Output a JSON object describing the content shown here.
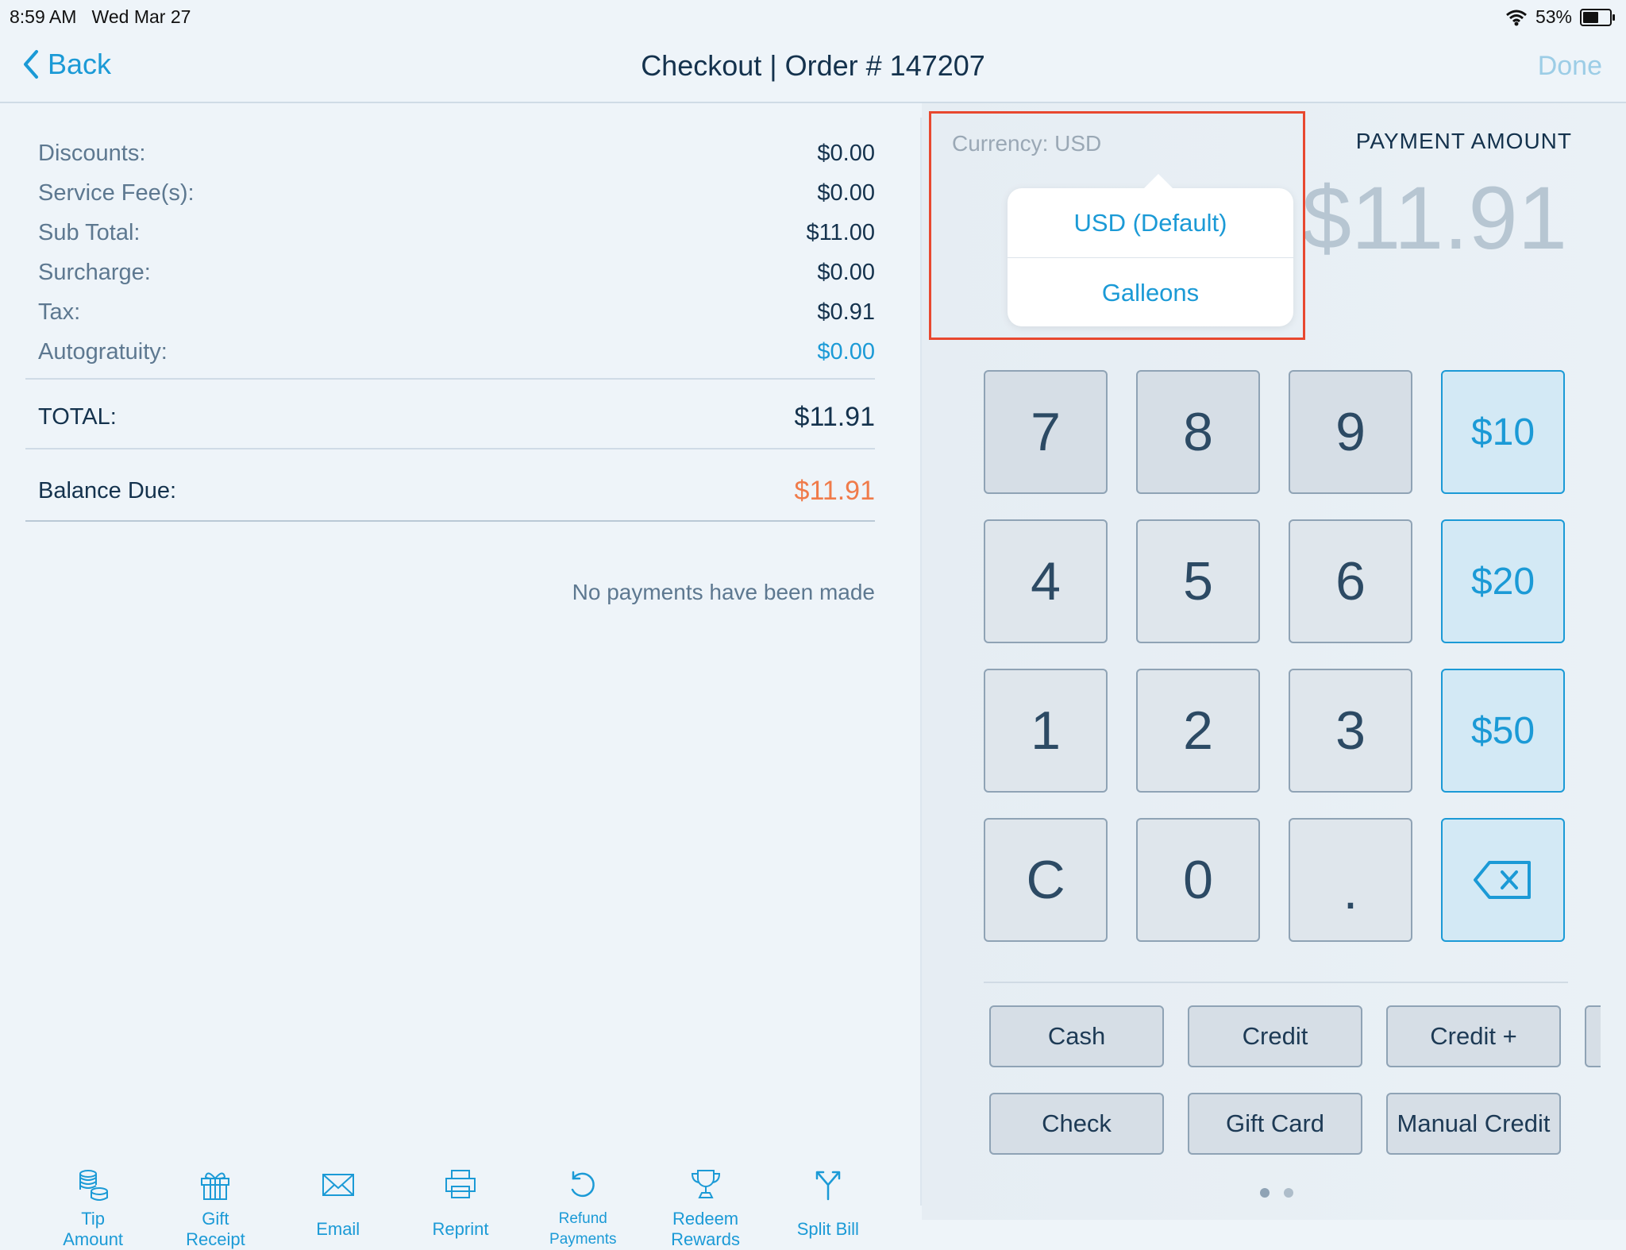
{
  "status": {
    "time_date": "8:59 AM   Wed Mar 27",
    "battery": "53%"
  },
  "nav": {
    "back": "Back",
    "title": "Checkout | Order # 147207",
    "done": "Done"
  },
  "summary": [
    {
      "label": "Discounts:",
      "value": "$0.00"
    },
    {
      "label": "Service Fee(s):",
      "value": "$0.00"
    },
    {
      "label": "Sub Total:",
      "value": "$11.00"
    },
    {
      "label": "Surcharge:",
      "value": "$0.00"
    },
    {
      "label": "Tax:",
      "value": "$0.91"
    },
    {
      "label": "Autogratuity:",
      "value": "$0.00"
    }
  ],
  "total": {
    "label": "TOTAL:",
    "value": "$11.91"
  },
  "balance": {
    "label": "Balance Due:",
    "value": "$11.91"
  },
  "no_payments": "No payments have been made",
  "actions": [
    {
      "label": "Tip\nAmount",
      "icon": "coins-icon"
    },
    {
      "label": "Gift\nReceipt",
      "icon": "gift-icon"
    },
    {
      "label": "Email",
      "icon": "envelope-icon"
    },
    {
      "label": "Reprint",
      "icon": "printer-icon"
    },
    {
      "label": "Refund\nPayments",
      "icon": "refund-icon"
    },
    {
      "label": "Redeem\nRewards",
      "icon": "trophy-icon"
    },
    {
      "label": "Split Bill",
      "icon": "split-icon"
    }
  ],
  "currency": {
    "label": "Currency: USD",
    "options": [
      "USD (Default)",
      "Galleons"
    ]
  },
  "payment": {
    "label": "PAYMENT AMOUNT",
    "amount": "$11.91"
  },
  "keypad": {
    "digits": [
      "7",
      "8",
      "9",
      "4",
      "5",
      "6",
      "1",
      "2",
      "3",
      "C",
      "0",
      "."
    ],
    "quick": [
      "$10",
      "$20",
      "$50"
    ]
  },
  "payment_buttons": [
    "Cash",
    "Credit",
    "Credit +",
    "Check",
    "Gift Card",
    "Manual Credit"
  ],
  "colors": {
    "accent": "#1b9ad6",
    "balance": "#f07b4a",
    "highlight_box": "#e8482f"
  }
}
